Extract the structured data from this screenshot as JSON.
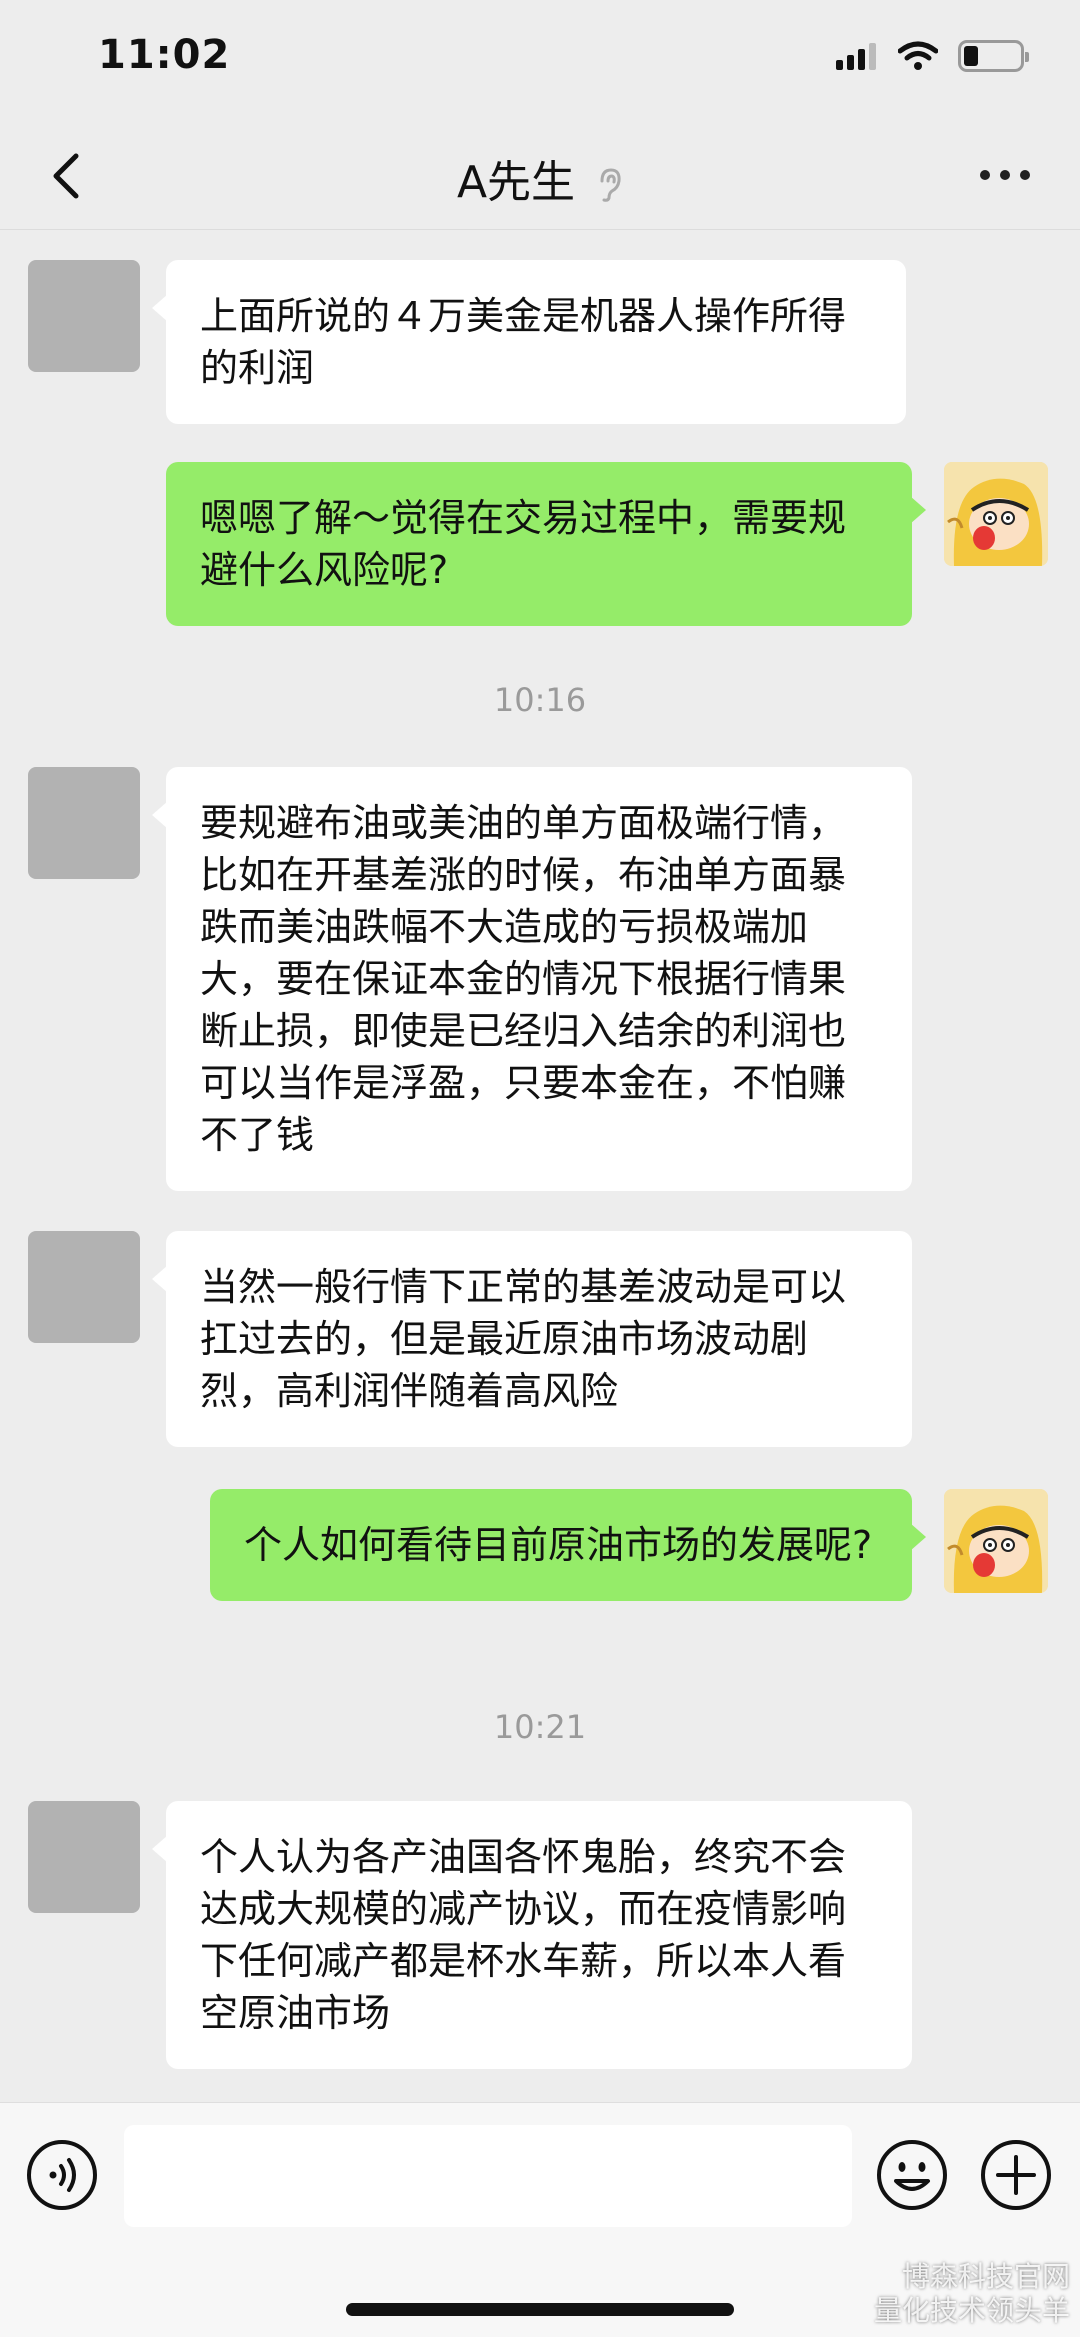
{
  "status_bar": {
    "time": "11:02"
  },
  "nav": {
    "title": "A先生"
  },
  "messages": [
    {
      "side": "in",
      "text": "上面所说的４万美金是机器人操作所得的利润"
    },
    {
      "side": "out",
      "text": "嗯嗯了解～觉得在交易过程中，需要规避什么风险呢?"
    },
    {
      "side": "in",
      "text": "要规避布油或美油的单方面极端行情，比如在开基差涨的时候，布油单方面暴跌而美油跌幅不大造成的亏损极端加大，要在保证本金的情况下根据行情果断止损，即使是已经归入结余的利润也可以当作是浮盈，只要本金在，不怕赚不了钱"
    },
    {
      "side": "in",
      "text": "当然一般行情下正常的基差波动是可以扛过去的，但是最近原油市场波动剧烈，高利润伴随着高风险"
    },
    {
      "side": "out",
      "text": "个人如何看待目前原油市场的发展呢?"
    },
    {
      "side": "in",
      "text": "个人认为各产油国各怀鬼胎，终究不会达成大规模的减产协议，而在疫情影响下任何减产都是杯水车薪，所以本人看空原油市场"
    }
  ],
  "timestamps": [
    "10:16",
    "10:21"
  ],
  "watermark": {
    "line1": "博森科技官网",
    "line2": "量化技术领头羊"
  },
  "colors": {
    "outgoing_bubble": "#95ec69",
    "incoming_bubble": "#ffffff",
    "background": "#ededed"
  }
}
